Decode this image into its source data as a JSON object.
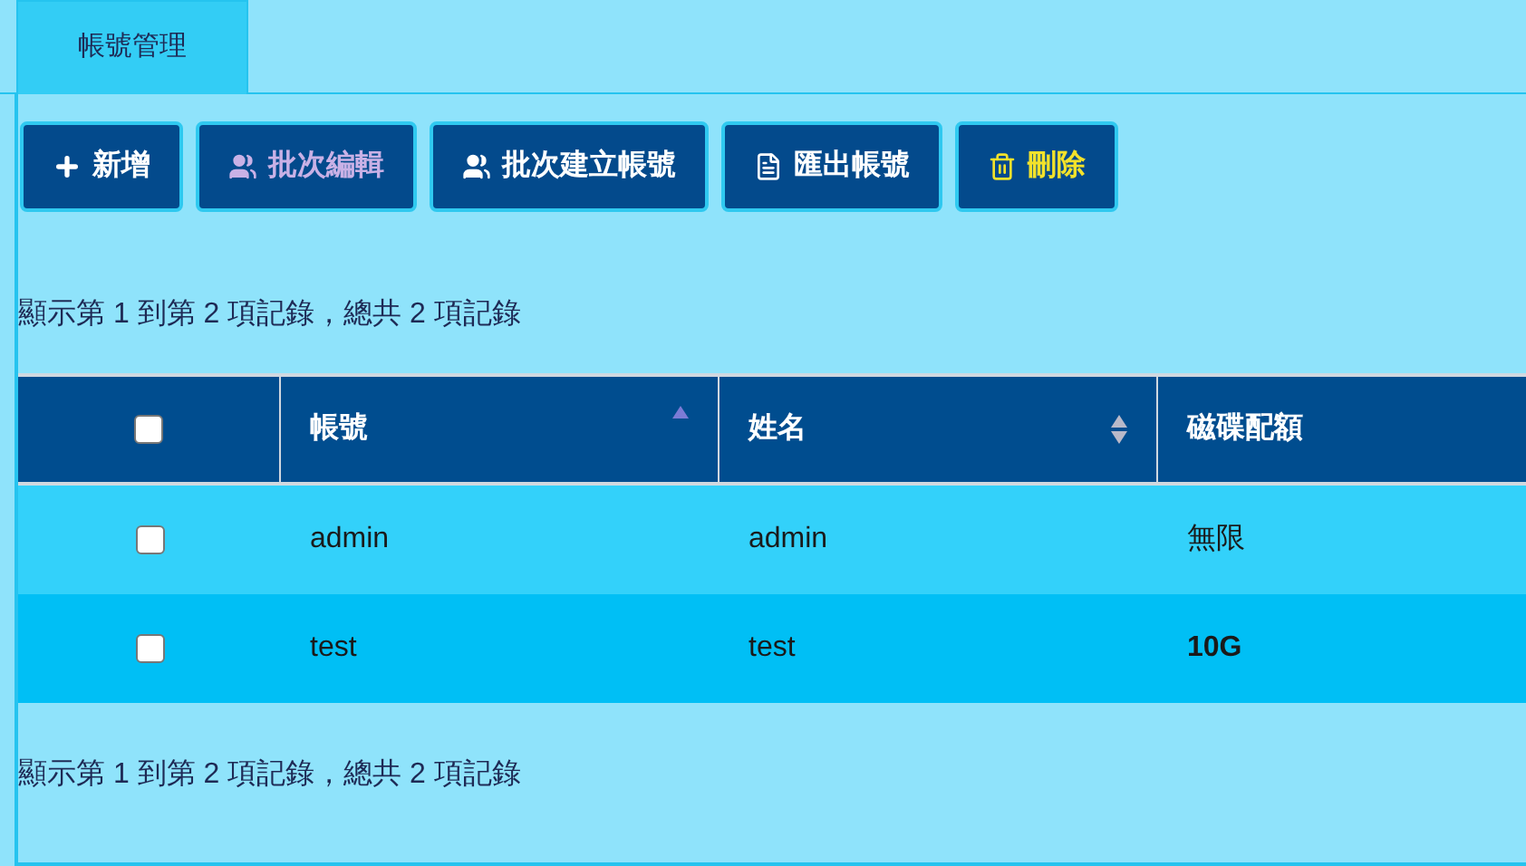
{
  "tabs": [
    {
      "label": "帳號管理",
      "selected": true
    }
  ],
  "toolbar": [
    {
      "kind": "add",
      "label": "新增",
      "disabled": false
    },
    {
      "kind": "group",
      "label": "批次編輯",
      "disabled": true
    },
    {
      "kind": "group",
      "label": "批次建立帳號",
      "disabled": false
    },
    {
      "kind": "export",
      "label": "匯出帳號",
      "disabled": false
    },
    {
      "kind": "delete",
      "label": "刪除",
      "disabled": false
    }
  ],
  "summary_top": "顯示第 1 到第 2 項記錄，總共 2 項記錄",
  "table": {
    "select_all": {
      "checked": false
    },
    "columns": [
      {
        "label": "帳號",
        "sortable": true,
        "sorted": true
      },
      {
        "label": "姓名",
        "sortable": true,
        "sorted": false
      },
      {
        "label": "磁碟配額",
        "sortable": false
      }
    ],
    "rows": [
      {
        "checked": false,
        "cells": [
          {
            "text": "admin",
            "bold": false
          },
          {
            "text": "admin",
            "bold": false
          },
          {
            "text": "無限",
            "bold": false
          }
        ]
      },
      {
        "checked": false,
        "cells": [
          {
            "text": "test",
            "bold": false
          },
          {
            "text": "test",
            "bold": false
          },
          {
            "text": "10G",
            "bold": true
          }
        ]
      }
    ]
  },
  "summary_bottom": "顯示第 1 到第 2 項記錄，總共 2 項記錄"
}
